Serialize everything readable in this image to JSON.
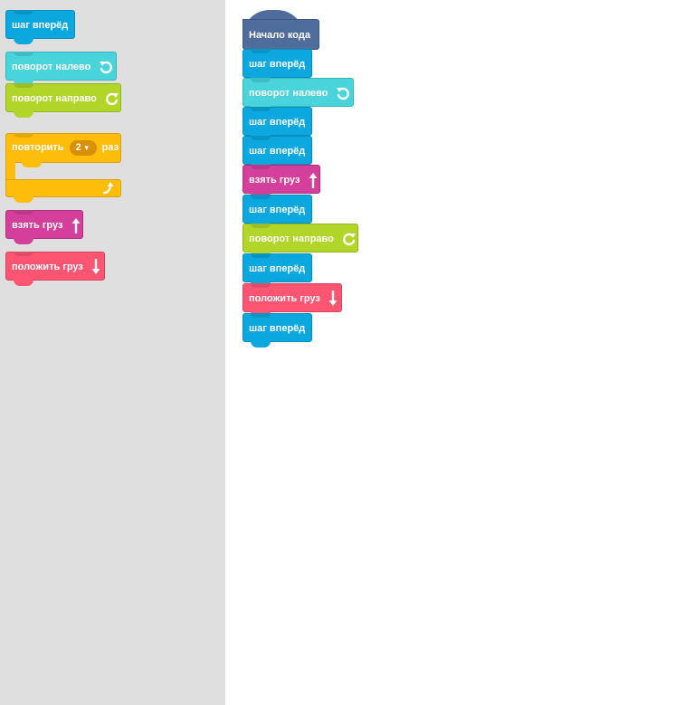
{
  "toolbox": {
    "blocks": {
      "move_forward": "шаг вперёд",
      "turn_left": "поворот налево",
      "turn_right": "поворот направо",
      "repeat_prefix": "повторить",
      "repeat_count": "2",
      "repeat_suffix": "раз",
      "take_cargo": "взять груз",
      "put_cargo": "положить груз"
    }
  },
  "workspace": {
    "start_label": "Начало кода",
    "program": [
      "шаг вперёд",
      "поворот налево",
      "шаг вперёд",
      "шаг вперёд",
      "взять груз",
      "шаг вперёд",
      "поворот направо",
      "шаг вперёд",
      "положить груз",
      "шаг вперёд"
    ]
  },
  "colors": {
    "move": "#0ba8df",
    "turn_left": "#49d4dc",
    "turn_right": "#b1d629",
    "repeat": "#ffbd0b",
    "take": "#d43f9c",
    "put": "#fe5573",
    "start": "#4e6c9c",
    "toolbox_bg": "#dfdfdf"
  },
  "icons": {
    "turn_left": "rotate-left-icon",
    "turn_right": "rotate-right-icon",
    "take": "arrow-up-icon",
    "put": "arrow-down-icon",
    "repeat": "loop-arrow-icon",
    "dropdown": "caret-down-icon"
  }
}
